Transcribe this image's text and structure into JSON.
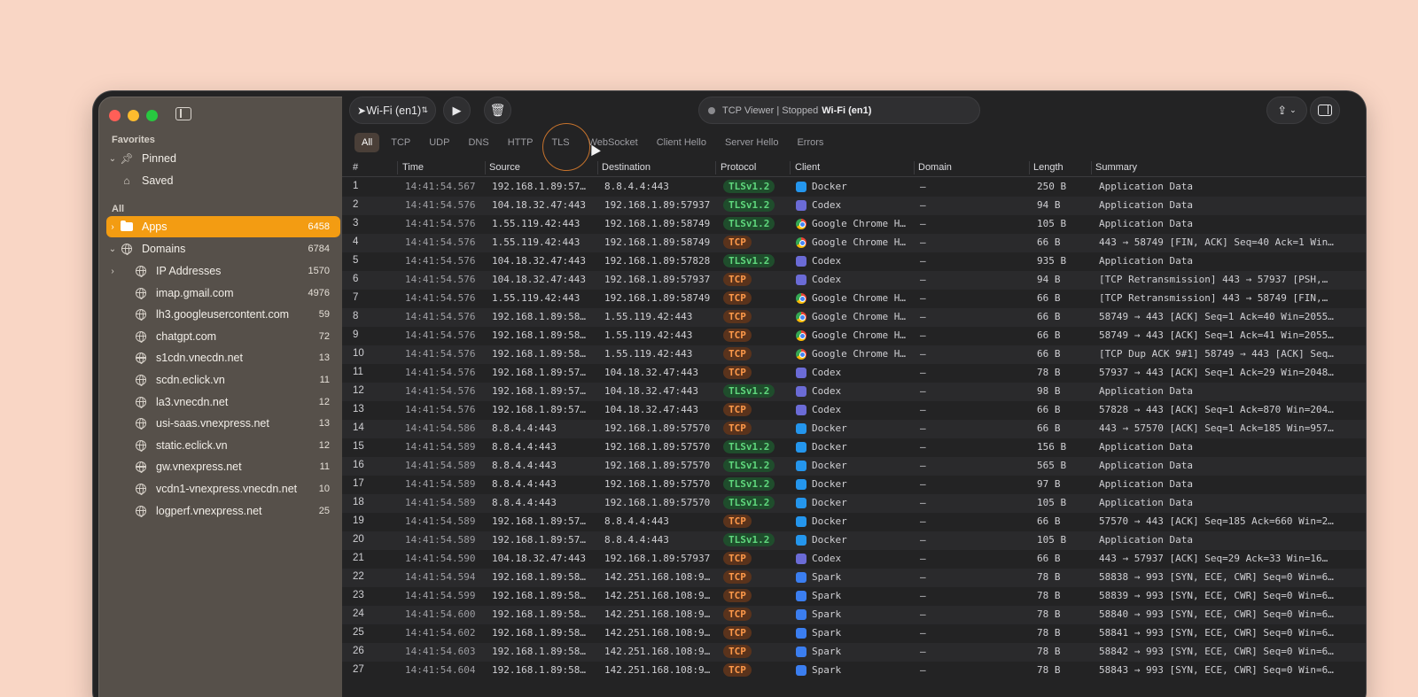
{
  "sidebar": {
    "favorites_label": "Favorites",
    "favorites": [
      {
        "label": "Pinned"
      },
      {
        "label": "Saved"
      }
    ],
    "all_label": "All",
    "apps": {
      "label": "Apps",
      "count": "6458"
    },
    "domains": {
      "label": "Domains",
      "count": "6784"
    },
    "domain_items": [
      {
        "label": "IP Addresses",
        "count": "1570"
      },
      {
        "label": "imap.gmail.com",
        "count": "4976"
      },
      {
        "label": "lh3.googleusercontent.com",
        "count": "59"
      },
      {
        "label": "chatgpt.com",
        "count": "72"
      },
      {
        "label": "s1cdn.vnecdn.net",
        "count": "13"
      },
      {
        "label": "scdn.eclick.vn",
        "count": "11"
      },
      {
        "label": "la3.vnecdn.net",
        "count": "12"
      },
      {
        "label": "usi-saas.vnexpress.net",
        "count": "13"
      },
      {
        "label": "static.eclick.vn",
        "count": "12"
      },
      {
        "label": "gw.vnexpress.net",
        "count": "11"
      },
      {
        "label": "vcdn1-vnexpress.vnecdn.net",
        "count": "10"
      },
      {
        "label": "logperf.vnexpress.net",
        "count": "25"
      }
    ]
  },
  "toolbar": {
    "interface": "Wi-Fi (en1)",
    "status_text": "TCP Viewer | Stopped",
    "status_iface": "Wi-Fi (en1)"
  },
  "tabs": [
    "All",
    "TCP",
    "UDP",
    "DNS",
    "HTTP",
    "TLS",
    "WebSocket",
    "Client Hello",
    "Server Hello",
    "Errors"
  ],
  "table": {
    "columns": [
      "#",
      "Time",
      "Source",
      "Destination",
      "Protocol",
      "Client",
      "Domain",
      "Length",
      "Summary"
    ],
    "rows": [
      {
        "n": "1",
        "time": "14:41:54.567",
        "src": "192.168.1.89:575…",
        "dst": "8.8.4.4:443",
        "proto": "TLSv1.2",
        "client": "Docker",
        "icon": "docker",
        "domain": "–",
        "len": "250 B",
        "sum": "Application Data"
      },
      {
        "n": "2",
        "time": "14:41:54.576",
        "src": "104.18.32.47:443",
        "dst": "192.168.1.89:57937",
        "proto": "TLSv1.2",
        "client": "Codex",
        "icon": "codex",
        "domain": "–",
        "len": "94 B",
        "sum": "Application Data"
      },
      {
        "n": "3",
        "time": "14:41:54.576",
        "src": "1.55.119.42:443",
        "dst": "192.168.1.89:58749",
        "proto": "TLSv1.2",
        "client": "Google Chrome H…",
        "icon": "chrome",
        "domain": "–",
        "len": "105 B",
        "sum": "Application Data"
      },
      {
        "n": "4",
        "time": "14:41:54.576",
        "src": "1.55.119.42:443",
        "dst": "192.168.1.89:58749",
        "proto": "TCP",
        "client": "Google Chrome H…",
        "icon": "chrome",
        "domain": "–",
        "len": "66 B",
        "sum": "443 → 58749 [FIN, ACK] Seq=40 Ack=1 Win…"
      },
      {
        "n": "5",
        "time": "14:41:54.576",
        "src": "104.18.32.47:443",
        "dst": "192.168.1.89:57828",
        "proto": "TLSv1.2",
        "client": "Codex",
        "icon": "codex",
        "domain": "–",
        "len": "935 B",
        "sum": "Application Data"
      },
      {
        "n": "6",
        "time": "14:41:54.576",
        "src": "104.18.32.47:443",
        "dst": "192.168.1.89:57937",
        "proto": "TCP",
        "client": "Codex",
        "icon": "codex",
        "domain": "–",
        "len": "94 B",
        "sum": "[TCP Retransmission] 443 → 57937 [PSH,…"
      },
      {
        "n": "7",
        "time": "14:41:54.576",
        "src": "1.55.119.42:443",
        "dst": "192.168.1.89:58749",
        "proto": "TCP",
        "client": "Google Chrome H…",
        "icon": "chrome",
        "domain": "–",
        "len": "66 B",
        "sum": "[TCP Retransmission] 443 → 58749 [FIN,…"
      },
      {
        "n": "8",
        "time": "14:41:54.576",
        "src": "192.168.1.89:587…",
        "dst": "1.55.119.42:443",
        "proto": "TCP",
        "client": "Google Chrome H…",
        "icon": "chrome",
        "domain": "–",
        "len": "66 B",
        "sum": "58749 → 443 [ACK] Seq=1 Ack=40 Win=2055…"
      },
      {
        "n": "9",
        "time": "14:41:54.576",
        "src": "192.168.1.89:587…",
        "dst": "1.55.119.42:443",
        "proto": "TCP",
        "client": "Google Chrome H…",
        "icon": "chrome",
        "domain": "–",
        "len": "66 B",
        "sum": "58749 → 443 [ACK] Seq=1 Ack=41 Win=2055…"
      },
      {
        "n": "10",
        "time": "14:41:54.576",
        "src": "192.168.1.89:587…",
        "dst": "1.55.119.42:443",
        "proto": "TCP",
        "client": "Google Chrome H…",
        "icon": "chrome",
        "domain": "–",
        "len": "66 B",
        "sum": "[TCP Dup ACK 9#1] 58749 → 443 [ACK] Seq…"
      },
      {
        "n": "11",
        "time": "14:41:54.576",
        "src": "192.168.1.89:579…",
        "dst": "104.18.32.47:443",
        "proto": "TCP",
        "client": "Codex",
        "icon": "codex",
        "domain": "–",
        "len": "78 B",
        "sum": "57937 → 443 [ACK] Seq=1 Ack=29 Win=2048…"
      },
      {
        "n": "12",
        "time": "14:41:54.576",
        "src": "192.168.1.89:579…",
        "dst": "104.18.32.47:443",
        "proto": "TLSv1.2",
        "client": "Codex",
        "icon": "codex",
        "domain": "–",
        "len": "98 B",
        "sum": "Application Data"
      },
      {
        "n": "13",
        "time": "14:41:54.576",
        "src": "192.168.1.89:578…",
        "dst": "104.18.32.47:443",
        "proto": "TCP",
        "client": "Codex",
        "icon": "codex",
        "domain": "–",
        "len": "66 B",
        "sum": "57828 → 443 [ACK] Seq=1 Ack=870 Win=204…"
      },
      {
        "n": "14",
        "time": "14:41:54.586",
        "src": "8.8.4.4:443",
        "dst": "192.168.1.89:57570",
        "proto": "TCP",
        "client": "Docker",
        "icon": "docker",
        "domain": "–",
        "len": "66 B",
        "sum": "443 → 57570 [ACK] Seq=1 Ack=185 Win=957…"
      },
      {
        "n": "15",
        "time": "14:41:54.589",
        "src": "8.8.4.4:443",
        "dst": "192.168.1.89:57570",
        "proto": "TLSv1.2",
        "client": "Docker",
        "icon": "docker",
        "domain": "–",
        "len": "156 B",
        "sum": "Application Data"
      },
      {
        "n": "16",
        "time": "14:41:54.589",
        "src": "8.8.4.4:443",
        "dst": "192.168.1.89:57570",
        "proto": "TLSv1.2",
        "client": "Docker",
        "icon": "docker",
        "domain": "–",
        "len": "565 B",
        "sum": "Application Data"
      },
      {
        "n": "17",
        "time": "14:41:54.589",
        "src": "8.8.4.4:443",
        "dst": "192.168.1.89:57570",
        "proto": "TLSv1.2",
        "client": "Docker",
        "icon": "docker",
        "domain": "–",
        "len": "97 B",
        "sum": "Application Data"
      },
      {
        "n": "18",
        "time": "14:41:54.589",
        "src": "8.8.4.4:443",
        "dst": "192.168.1.89:57570",
        "proto": "TLSv1.2",
        "client": "Docker",
        "icon": "docker",
        "domain": "–",
        "len": "105 B",
        "sum": "Application Data"
      },
      {
        "n": "19",
        "time": "14:41:54.589",
        "src": "192.168.1.89:575…",
        "dst": "8.8.4.4:443",
        "proto": "TCP",
        "client": "Docker",
        "icon": "docker",
        "domain": "–",
        "len": "66 B",
        "sum": "57570 → 443 [ACK] Seq=185 Ack=660 Win=2…"
      },
      {
        "n": "20",
        "time": "14:41:54.589",
        "src": "192.168.1.89:575…",
        "dst": "8.8.4.4:443",
        "proto": "TLSv1.2",
        "client": "Docker",
        "icon": "docker",
        "domain": "–",
        "len": "105 B",
        "sum": "Application Data"
      },
      {
        "n": "21",
        "time": "14:41:54.590",
        "src": "104.18.32.47:443",
        "dst": "192.168.1.89:57937",
        "proto": "TCP",
        "client": "Codex",
        "icon": "codex",
        "domain": "–",
        "len": "66 B",
        "sum": "443 → 57937 [ACK] Seq=29 Ack=33 Win=16…"
      },
      {
        "n": "22",
        "time": "14:41:54.594",
        "src": "192.168.1.89:588…",
        "dst": "142.251.168.108:9…",
        "proto": "TCP",
        "client": "Spark",
        "icon": "spark",
        "domain": "–",
        "len": "78 B",
        "sum": "58838 → 993 [SYN, ECE, CWR] Seq=0 Win=6…"
      },
      {
        "n": "23",
        "time": "14:41:54.599",
        "src": "192.168.1.89:588…",
        "dst": "142.251.168.108:9…",
        "proto": "TCP",
        "client": "Spark",
        "icon": "spark",
        "domain": "–",
        "len": "78 B",
        "sum": "58839 → 993 [SYN, ECE, CWR] Seq=0 Win=6…"
      },
      {
        "n": "24",
        "time": "14:41:54.600",
        "src": "192.168.1.89:588…",
        "dst": "142.251.168.108:9…",
        "proto": "TCP",
        "client": "Spark",
        "icon": "spark",
        "domain": "–",
        "len": "78 B",
        "sum": "58840 → 993 [SYN, ECE, CWR] Seq=0 Win=6…"
      },
      {
        "n": "25",
        "time": "14:41:54.602",
        "src": "192.168.1.89:588…",
        "dst": "142.251.168.108:9…",
        "proto": "TCP",
        "client": "Spark",
        "icon": "spark",
        "domain": "–",
        "len": "78 B",
        "sum": "58841 → 993 [SYN, ECE, CWR] Seq=0 Win=6…"
      },
      {
        "n": "26",
        "time": "14:41:54.603",
        "src": "192.168.1.89:588…",
        "dst": "142.251.168.108:9…",
        "proto": "TCP",
        "client": "Spark",
        "icon": "spark",
        "domain": "–",
        "len": "78 B",
        "sum": "58842 → 993 [SYN, ECE, CWR] Seq=0 Win=6…"
      },
      {
        "n": "27",
        "time": "14:41:54.604",
        "src": "192.168.1.89:588…",
        "dst": "142.251.168.108:9…",
        "proto": "TCP",
        "client": "Spark",
        "icon": "spark",
        "domain": "–",
        "len": "78 B",
        "sum": "58843 → 993 [SYN, ECE, CWR] Seq=0 Win=6…"
      }
    ]
  }
}
